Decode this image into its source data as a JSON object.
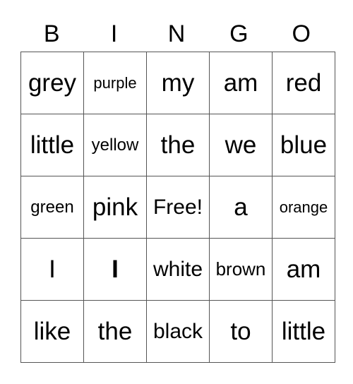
{
  "header": [
    "B",
    "I",
    "N",
    "G",
    "O"
  ],
  "rows": [
    [
      "grey",
      "purple",
      "my",
      "am",
      "red"
    ],
    [
      "little",
      "yellow",
      "the",
      "we",
      "blue"
    ],
    [
      "green",
      "pink",
      "Free!",
      "a",
      "orange"
    ],
    [
      "I",
      "I",
      "white",
      "brown",
      "am"
    ],
    [
      "like",
      "the",
      "black",
      "to",
      "little"
    ]
  ]
}
